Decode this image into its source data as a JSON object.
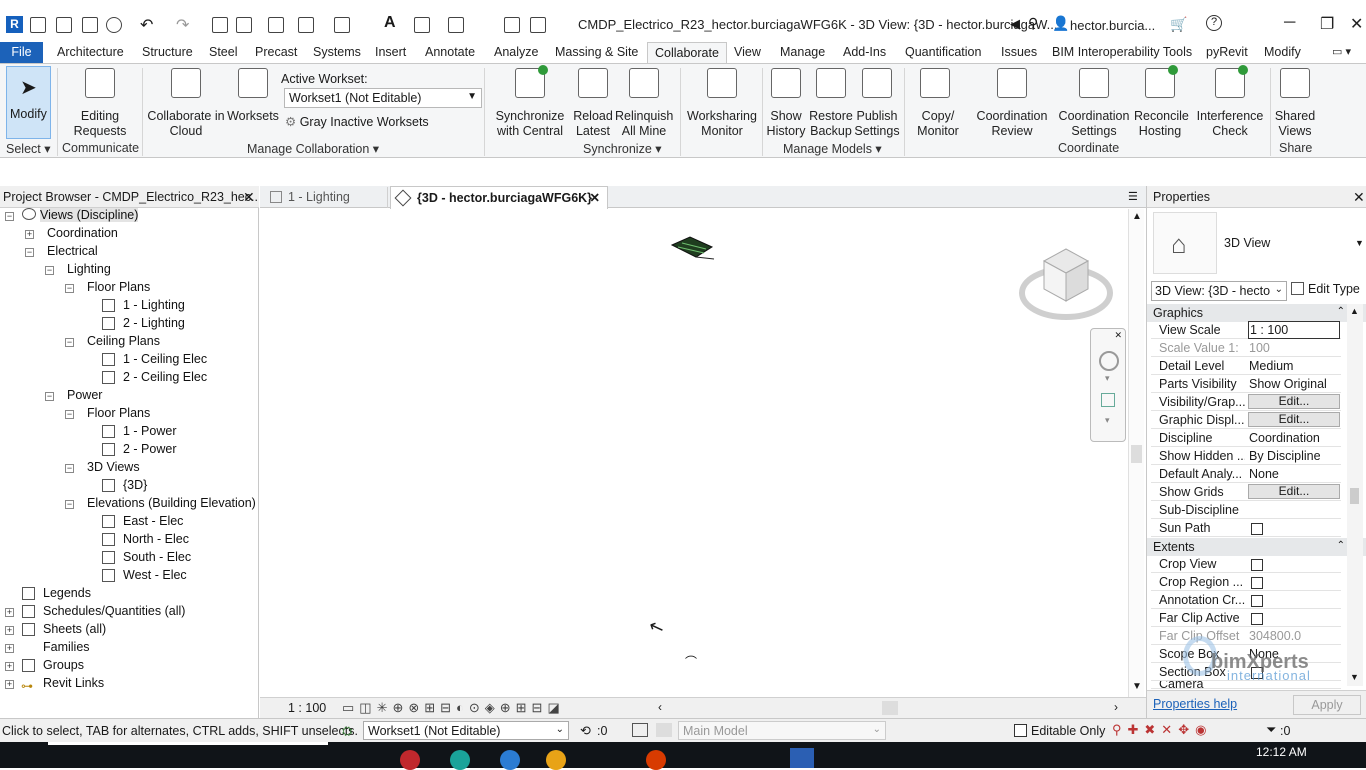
{
  "app": {
    "logo": "R",
    "title": "CMDP_Electrico_R23_hector.burciagaWFG6K - 3D View: {3D - hector.burciagaW...",
    "user": "hector.burcia..."
  },
  "tabs": {
    "file": "File",
    "items": [
      "Architecture",
      "Structure",
      "Steel",
      "Precast",
      "Systems",
      "Insert",
      "Annotate",
      "Analyze",
      "Massing & Site",
      "Collaborate",
      "View",
      "Manage",
      "Add-Ins",
      "Quantification",
      "Issues",
      "BIM Interoperability Tools",
      "pyRevit",
      "Modify"
    ],
    "active": "Collaborate"
  },
  "ribbon": {
    "modify": "Modify",
    "editing_requests": [
      "Editing",
      "Requests"
    ],
    "collab_cloud": [
      "Collaborate in",
      "Cloud"
    ],
    "worksets": "Worksets",
    "active_workset_label": "Active Workset:",
    "active_workset_value": "Workset1 (Not Editable)",
    "gray_inactive": "Gray Inactive Worksets",
    "sync_central": [
      "Synchronize",
      "with Central"
    ],
    "reload_latest": [
      "Reload",
      "Latest"
    ],
    "relinquish": [
      "Relinquish",
      "All Mine"
    ],
    "worksharing_monitor": [
      "Worksharing",
      "Monitor"
    ],
    "show_history": [
      "Show",
      "History"
    ],
    "restore_backup": [
      "Restore",
      "Backup"
    ],
    "publish_settings": [
      "Publish",
      "Settings"
    ],
    "copy_monitor": [
      "Copy/",
      "Monitor"
    ],
    "coordination_review": [
      "Coordination",
      "Review"
    ],
    "coordination_settings": [
      "Coordination",
      "Settings"
    ],
    "reconcile_hosting": [
      "Reconcile",
      "Hosting"
    ],
    "interference_check": [
      "Interference",
      "Check"
    ],
    "shared_views": [
      "Shared",
      "Views"
    ],
    "panels": {
      "select": "Select",
      "communicate": "Communicate",
      "manage_collab": "Manage Collaboration",
      "synchronize": "Synchronize",
      "manage_models": "Manage Models",
      "coordinate": "Coordinate",
      "share": "Share"
    }
  },
  "project_browser": {
    "title": "Project Browser - CMDP_Electrico_R23_hec...",
    "root": "Views (Discipline)",
    "coordination": "Coordination",
    "electrical": "Electrical",
    "lighting": "Lighting",
    "floor_plans": "Floor Plans",
    "light_fp": [
      "1 - Lighting",
      "2 - Lighting"
    ],
    "ceiling_plans": "Ceiling Plans",
    "ceiling": [
      "1 - Ceiling Elec",
      "2 - Ceiling Elec"
    ],
    "power": "Power",
    "power_fp": [
      "1 - Power",
      "2 - Power"
    ],
    "views_3d": "3D Views",
    "view_3d": "{3D}",
    "elevations": "Elevations (Building Elevation)",
    "elev": [
      "East - Elec",
      "North - Elec",
      "South - Elec",
      "West - Elec"
    ],
    "others": [
      "Legends",
      "Schedules/Quantities (all)",
      "Sheets (all)",
      "Families",
      "Groups",
      "Revit Links"
    ]
  },
  "view_tabs": {
    "tab1": "1 - Lighting",
    "tab2": "{3D - hector.burciagaWFG6K}"
  },
  "view_status": {
    "scale": "1 : 100"
  },
  "properties": {
    "title": "Properties",
    "type": "3D View",
    "selector": "3D View: {3D - hecto",
    "edit_type": "Edit Type",
    "graphics": "Graphics",
    "rows": [
      {
        "label": "View Scale",
        "value": "1 : 100"
      },
      {
        "label": "Scale Value    1:",
        "value": "100"
      },
      {
        "label": "Detail Level",
        "value": "Medium"
      },
      {
        "label": "Parts Visibility",
        "value": "Show Original"
      },
      {
        "label": "Visibility/Grap...",
        "value": "Edit..."
      },
      {
        "label": "Graphic Displ...",
        "value": "Edit..."
      },
      {
        "label": "Discipline",
        "value": "Coordination"
      },
      {
        "label": "Show Hidden ...",
        "value": "By Discipline"
      },
      {
        "label": "Default Analy...",
        "value": "None"
      },
      {
        "label": "Show Grids",
        "value": "Edit..."
      },
      {
        "label": "Sub-Discipline",
        "value": ""
      },
      {
        "label": "Sun Path",
        "value": ""
      }
    ],
    "extents": "Extents",
    "ext_rows": [
      {
        "label": "Crop View"
      },
      {
        "label": "Crop Region ..."
      },
      {
        "label": "Annotation Cr..."
      },
      {
        "label": "Far Clip Active"
      },
      {
        "label": "Far Clip Offset",
        "value": "304800.0"
      },
      {
        "label": "Scope Box",
        "value": "None"
      },
      {
        "label": "Section Box"
      },
      {
        "label": "Camera"
      }
    ],
    "help": "Properties help",
    "apply": "Apply"
  },
  "watermark": {
    "brand": "bimXperts",
    "sub": "international"
  },
  "status": {
    "hint": "Click to select, TAB for alternates, CTRL adds, SHIFT unselects.",
    "workset": "Workset1 (Not Editable)",
    "zero1": ":0",
    "main_model": "Main Model",
    "editable_only": "Editable Only",
    "zero2": ":0",
    "clock": "12:12 AM"
  },
  "colors": {
    "accent": "#1c62b9",
    "file_tab": "#1c62b9",
    "highlight": "#cfe4f7"
  }
}
